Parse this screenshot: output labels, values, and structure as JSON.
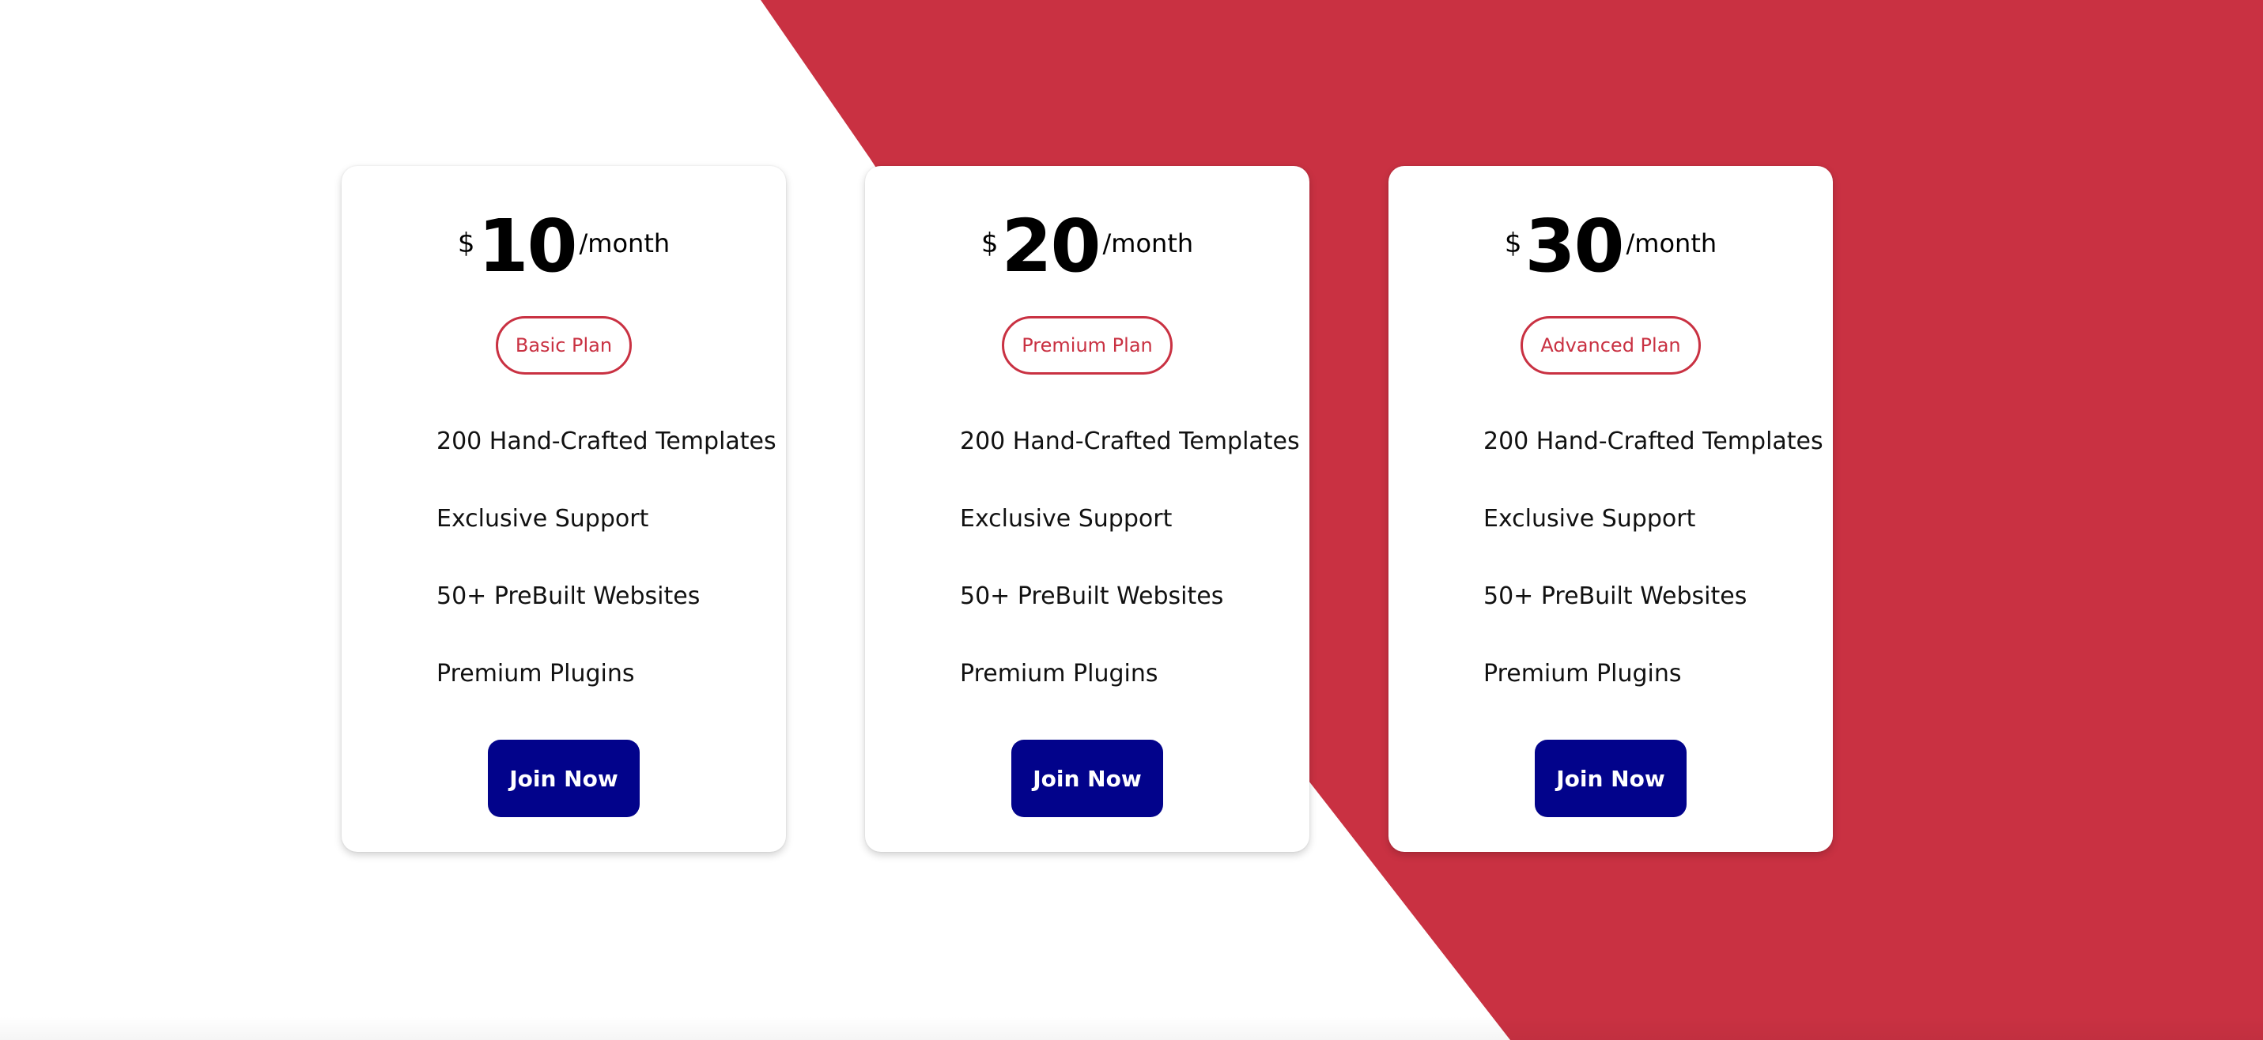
{
  "colors": {
    "accent_red": "#c93142",
    "button_navy": "#02038b",
    "background": "#ffffff"
  },
  "plans": [
    {
      "currency": "$",
      "amount": "10",
      "period": "/month",
      "plan_name": "Basic Plan",
      "features": [
        "200 Hand-Crafted Templates",
        "Exclusive Support",
        "50+ PreBuilt Websites",
        "Premium Plugins"
      ],
      "button_label": "Join Now"
    },
    {
      "currency": "$",
      "amount": "20",
      "period": "/month",
      "plan_name": "Premium Plan",
      "features": [
        "200 Hand-Crafted Templates",
        "Exclusive Support",
        "50+ PreBuilt Websites",
        "Premium Plugins"
      ],
      "button_label": "Join Now"
    },
    {
      "currency": "$",
      "amount": "30",
      "period": "/month",
      "plan_name": "Advanced Plan",
      "features": [
        "200 Hand-Crafted Templates",
        "Exclusive Support",
        "50+ PreBuilt Websites",
        "Premium Plugins"
      ],
      "button_label": "Join Now"
    }
  ]
}
